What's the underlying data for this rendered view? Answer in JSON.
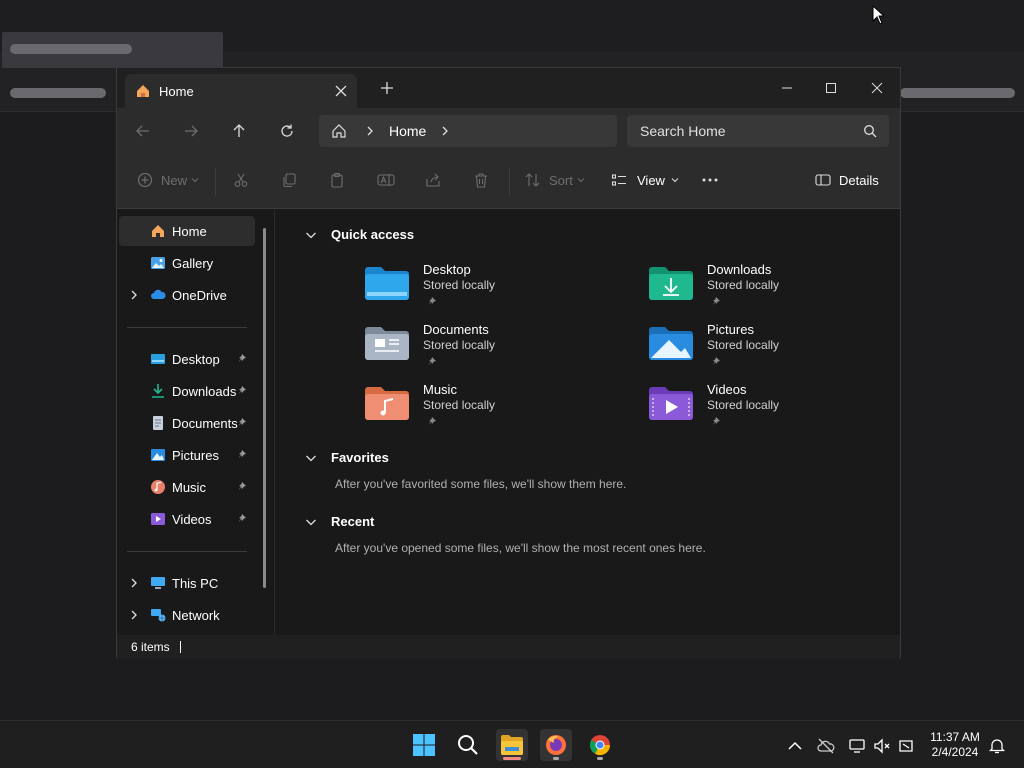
{
  "window": {
    "tab_title": "Home",
    "address": "Home",
    "search_placeholder": "Search Home"
  },
  "toolbar": {
    "new_label": "New",
    "sort_label": "Sort",
    "view_label": "View",
    "details_label": "Details"
  },
  "sidebar": {
    "top": [
      {
        "label": "Home"
      },
      {
        "label": "Gallery"
      },
      {
        "label": "OneDrive"
      }
    ],
    "pinned": [
      {
        "label": "Desktop"
      },
      {
        "label": "Downloads"
      },
      {
        "label": "Documents"
      },
      {
        "label": "Pictures"
      },
      {
        "label": "Music"
      },
      {
        "label": "Videos"
      }
    ],
    "bottom": [
      {
        "label": "This PC"
      },
      {
        "label": "Network"
      }
    ]
  },
  "content": {
    "quick_access_title": "Quick access",
    "quick_access": [
      {
        "name": "Desktop",
        "sub": "Stored locally"
      },
      {
        "name": "Downloads",
        "sub": "Stored locally"
      },
      {
        "name": "Documents",
        "sub": "Stored locally"
      },
      {
        "name": "Pictures",
        "sub": "Stored locally"
      },
      {
        "name": "Music",
        "sub": "Stored locally"
      },
      {
        "name": "Videos",
        "sub": "Stored locally"
      }
    ],
    "favorites_title": "Favorites",
    "favorites_empty": "After you've favorited some files, we'll show them here.",
    "recent_title": "Recent",
    "recent_empty": "After you've opened some files, we'll show the most recent ones here."
  },
  "status": {
    "items": "6 items"
  },
  "taskbar": {
    "time": "11:37 AM",
    "date": "2/4/2024"
  },
  "colors": {
    "accent": "#4cc2ff",
    "desktop_folder": "#2a9fe0",
    "downloads_folder": "#1fb88f",
    "documents_folder": "#9aa7b8",
    "pictures_folder": "#2a8ce0",
    "music_folder": "#e8806a",
    "videos_folder": "#8a5ad8"
  }
}
